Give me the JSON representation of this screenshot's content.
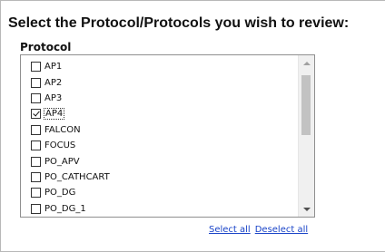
{
  "page": {
    "title": "Select the Protocol/Protocols you wish to review:"
  },
  "protocol_list": {
    "label": "Protocol",
    "items": [
      {
        "label": "AP1",
        "checked": false
      },
      {
        "label": "AP2",
        "checked": false
      },
      {
        "label": "AP3",
        "checked": false
      },
      {
        "label": "AP4",
        "checked": true,
        "focused": true
      },
      {
        "label": "FALCON",
        "checked": false
      },
      {
        "label": "FOCUS",
        "checked": false
      },
      {
        "label": "PO_APV",
        "checked": false
      },
      {
        "label": "PO_CATHCART",
        "checked": false
      },
      {
        "label": "PO_DG",
        "checked": false
      },
      {
        "label": "PO_DG_1",
        "checked": false
      }
    ]
  },
  "actions": {
    "select_all": "Select all",
    "deselect_all": "Deselect all"
  },
  "colors": {
    "link": "#1a44c8",
    "scroll_thumb": "#c2c2c2"
  }
}
